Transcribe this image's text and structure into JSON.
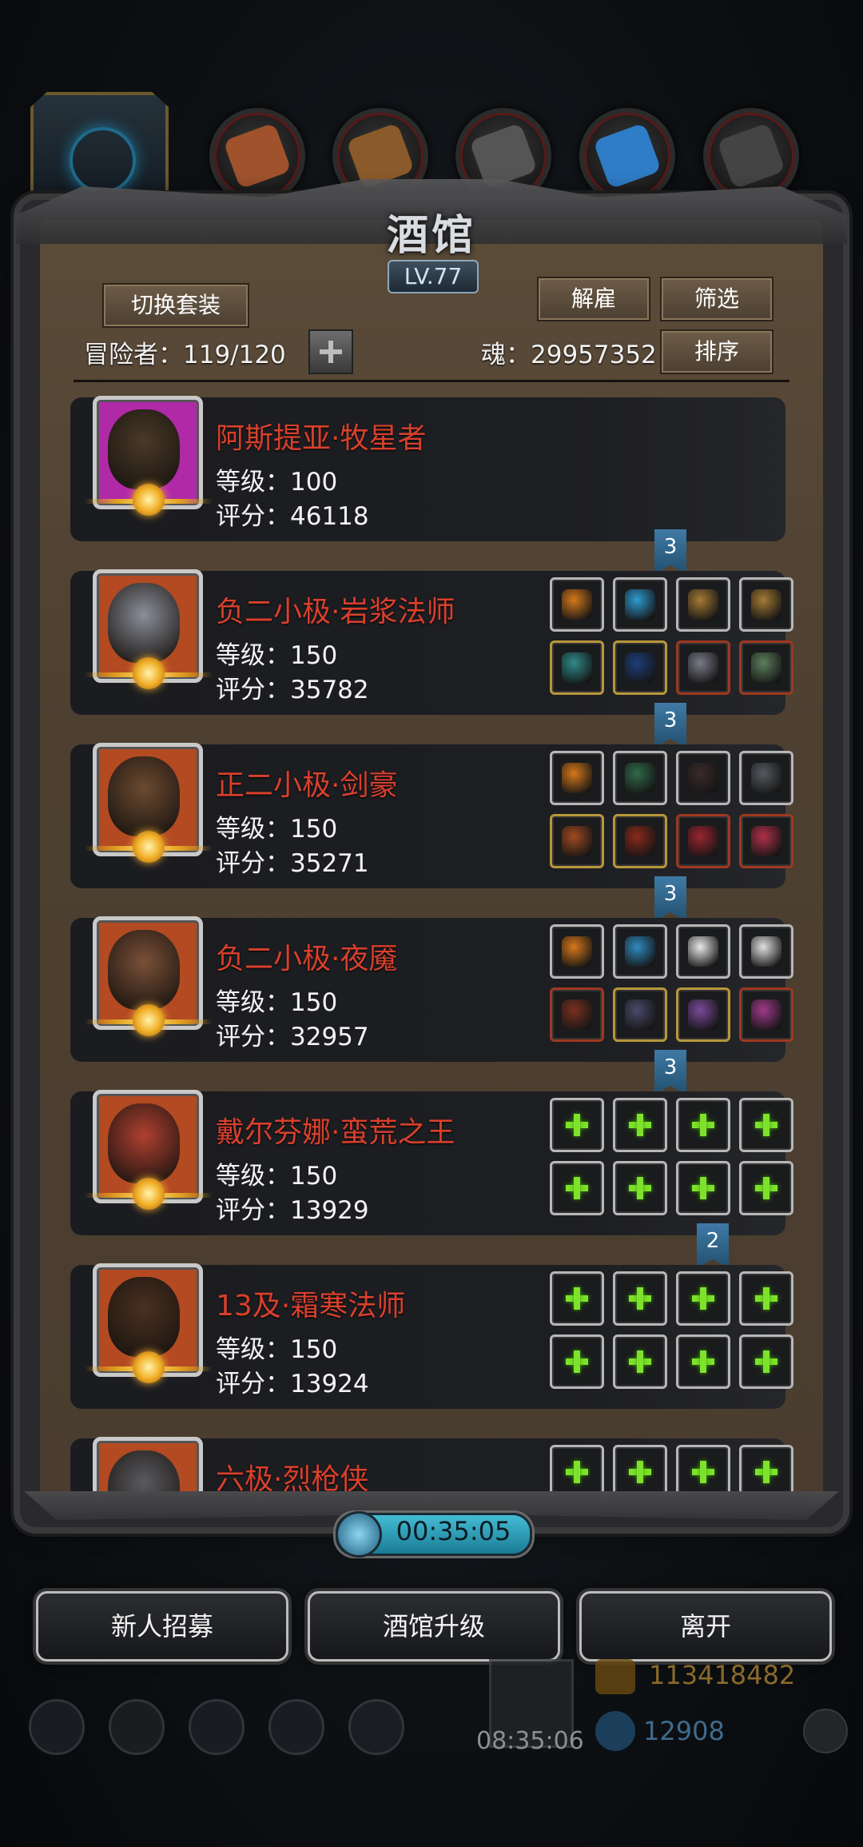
{
  "window": {
    "title": "酒馆",
    "level": "LV.77"
  },
  "top_categories": [
    {
      "name": "hero",
      "icon": "hero-emblem-icon",
      "color": "#1e7aa0"
    },
    {
      "name": "cat-1",
      "icon": "leather-armor-icon",
      "color": "#a0522d"
    },
    {
      "name": "cat-2",
      "icon": "wood-icon",
      "color": "#8a5a2a"
    },
    {
      "name": "cat-3",
      "icon": "iron-icon",
      "color": "#555555"
    },
    {
      "name": "cat-4",
      "icon": "crystal-icon",
      "color": "#2f7cc7"
    },
    {
      "name": "cat-5",
      "icon": "metal-bar-icon",
      "color": "#444444"
    }
  ],
  "header": {
    "switch_set_label": "切换套装",
    "dismiss_label": "解雇",
    "filter_label": "筛选",
    "sort_label": "排序",
    "adventurers_text": "冒险者：119/120",
    "soul_text": "魂：29957352"
  },
  "adventurers": [
    {
      "name": "阿斯提亚·牧星者",
      "level": "等级：100",
      "score": "评分：46118",
      "frame": "#b02aa8",
      "face": "#4a3a28",
      "slots": []
    },
    {
      "name": "负二小极·岩浆法师",
      "level": "等级：150",
      "score": "评分：35782",
      "frame": "#b34a22",
      "face": "#8a8f9a",
      "ribbon": "3",
      "slots": [
        {
          "border": "white",
          "color": "#d6781a"
        },
        {
          "border": "white",
          "color": "#2f9bd3"
        },
        {
          "border": "white",
          "color": "#a57a35"
        },
        {
          "border": "white",
          "color": "#a57a35"
        },
        {
          "border": "gold",
          "color": "#2f8a8a"
        },
        {
          "border": "gold",
          "color": "#1d3e7a"
        },
        {
          "border": "red",
          "color": "#7a7a88"
        },
        {
          "border": "red",
          "color": "#5d7f5d"
        }
      ]
    },
    {
      "name": "正二小极·剑豪",
      "level": "等级：150",
      "score": "评分：35271",
      "frame": "#b34a22",
      "face": "#6b4a30",
      "ribbon": "3",
      "slots": [
        {
          "border": "white",
          "color": "#d6781a"
        },
        {
          "border": "white",
          "color": "#2f6a4a"
        },
        {
          "border": "white",
          "color": "#3a2a2a"
        },
        {
          "border": "white",
          "color": "#555a60"
        },
        {
          "border": "gold",
          "color": "#a04a20"
        },
        {
          "border": "gold",
          "color": "#8a2a1a"
        },
        {
          "border": "red",
          "color": "#9a2530"
        },
        {
          "border": "red",
          "color": "#b0304a"
        }
      ]
    },
    {
      "name": "负二小极·夜魇",
      "level": "等级：150",
      "score": "评分：32957",
      "frame": "#b34a22",
      "face": "#7a5038",
      "ribbon": "3",
      "slots": [
        {
          "border": "white",
          "color": "#d6781a"
        },
        {
          "border": "white",
          "color": "#2f8ac0"
        },
        {
          "border": "white",
          "color": "#e8e8e8"
        },
        {
          "border": "white",
          "color": "#e0e0e0"
        },
        {
          "border": "red",
          "color": "#7a3020"
        },
        {
          "border": "gold",
          "color": "#4a4a6a"
        },
        {
          "border": "gold",
          "color": "#7a4a9a"
        },
        {
          "border": "red",
          "color": "#a03a8a"
        }
      ]
    },
    {
      "name": "戴尔芬娜·蛮荒之王",
      "level": "等级：150",
      "score": "评分：13929",
      "frame": "#b34a22",
      "face": "#b04030",
      "ribbon": "3",
      "slots": [
        {
          "border": "white",
          "plus": true
        },
        {
          "border": "white",
          "plus": true
        },
        {
          "border": "white",
          "plus": true
        },
        {
          "border": "white",
          "plus": true
        },
        {
          "border": "white",
          "plus": true
        },
        {
          "border": "white",
          "plus": true
        },
        {
          "border": "white",
          "plus": true
        },
        {
          "border": "white",
          "plus": true
        }
      ]
    },
    {
      "name": "13及·霜寒法师",
      "level": "等级：150",
      "score": "评分：13924",
      "frame": "#b34a22",
      "face": "#4a3020",
      "ribbon": "2",
      "slots": [
        {
          "border": "white",
          "plus": true
        },
        {
          "border": "white",
          "plus": true
        },
        {
          "border": "white",
          "plus": true
        },
        {
          "border": "white",
          "plus": true
        },
        {
          "border": "white",
          "plus": true
        },
        {
          "border": "white",
          "plus": true
        },
        {
          "border": "white",
          "plus": true
        },
        {
          "border": "white",
          "plus": true
        }
      ]
    },
    {
      "name": "六极·烈枪侠",
      "level": "",
      "score": "",
      "frame": "#b34a22",
      "face": "#5a5a60",
      "slots": [
        {
          "border": "white",
          "plus": true
        },
        {
          "border": "white",
          "plus": true
        },
        {
          "border": "white",
          "plus": true
        },
        {
          "border": "white",
          "plus": true
        }
      ]
    }
  ],
  "timer": {
    "value": "00:35:05",
    "icon": "clock-icon"
  },
  "actions": {
    "recruit_label": "新人招募",
    "upgrade_label": "酒馆升级",
    "leave_label": "离开"
  },
  "hud": {
    "time": "08:35:06",
    "gold": "113418482",
    "gems": "12908"
  }
}
